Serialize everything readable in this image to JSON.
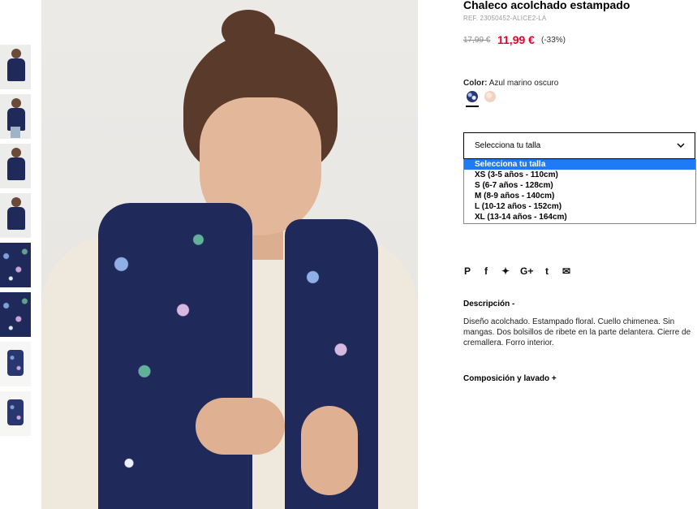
{
  "product": {
    "title": "Chaleco acolchado estampado",
    "ref": "REF. 23050452-ALICE2-LA",
    "price_old": "17,99 €",
    "price_new": "11,99 €",
    "discount": "(-33%)"
  },
  "color": {
    "label": "Color:",
    "value": "Azul marino oscuro",
    "swatches": [
      "navy-floral",
      "peach"
    ],
    "accent": "#e4002b"
  },
  "size_select": {
    "placeholder": "Selecciona tu talla",
    "options": [
      "Selecciona tu talla",
      "XS (3-5 años - 110cm)",
      "S (6-7 años - 128cm)",
      "M (8-9 años - 140cm)",
      "L (10-12 años - 152cm)",
      "XL (13-14 años - 164cm)"
    ],
    "highlight_color": "#1e7bf5"
  },
  "social": {
    "icons": [
      "pinterest-icon",
      "facebook-icon",
      "twitter-icon",
      "google-plus-icon",
      "tumblr-icon",
      "email-icon"
    ],
    "glyphs": [
      "P",
      "f",
      "✦",
      "G+",
      "t",
      "✉"
    ]
  },
  "description": {
    "title": "Descripción -",
    "text": "Diseño acolchado. Estampado floral. Cuello chimenea. Sin mangas. Dos bolsillos de ribete en la parte delantera. Cierre de cremallera. Forro interior."
  },
  "composition": {
    "title": "Composición y lavado +"
  }
}
